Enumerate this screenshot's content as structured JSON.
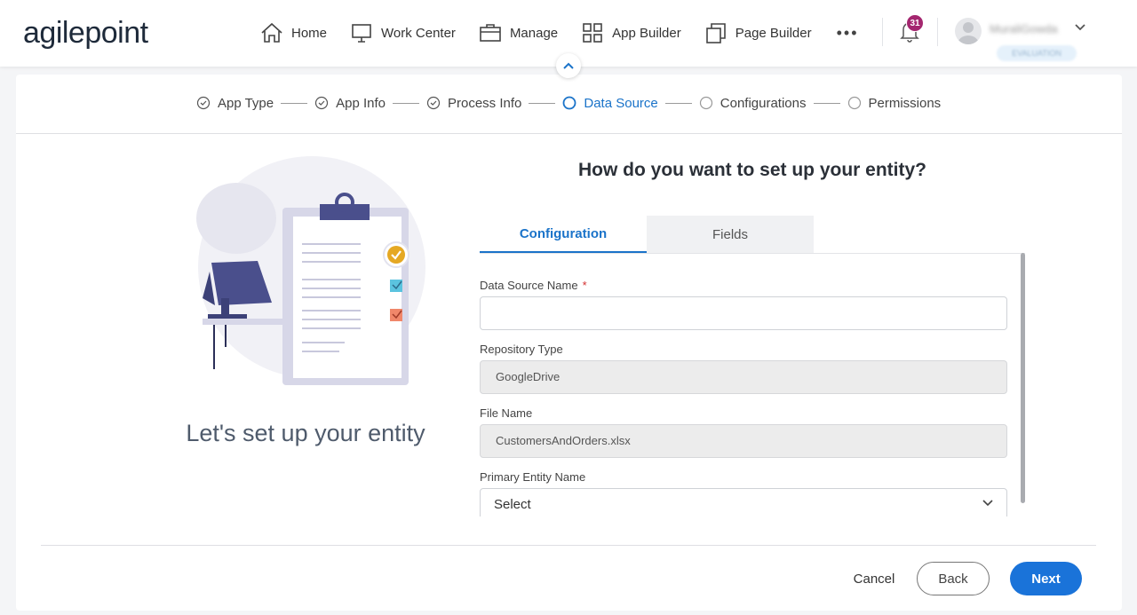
{
  "brand": {
    "logo_text": "agilepoint"
  },
  "nav": {
    "items": [
      {
        "label": "Home",
        "icon": "home-icon"
      },
      {
        "label": "Work Center",
        "icon": "monitor-icon"
      },
      {
        "label": "Manage",
        "icon": "briefcase-icon"
      },
      {
        "label": "App Builder",
        "icon": "grid-icon"
      },
      {
        "label": "Page Builder",
        "icon": "pages-icon"
      }
    ],
    "more_label": "•••",
    "notification_count": "31",
    "user_name": "MuraliGowda",
    "user_badge": "EVALUATION"
  },
  "stepper": {
    "steps": [
      {
        "label": "App Type",
        "state": "done"
      },
      {
        "label": "App Info",
        "state": "done"
      },
      {
        "label": "Process Info",
        "state": "done"
      },
      {
        "label": "Data Source",
        "state": "active"
      },
      {
        "label": "Configurations",
        "state": "pending"
      },
      {
        "label": "Permissions",
        "state": "pending"
      }
    ]
  },
  "left_panel": {
    "title": "Let's set up your entity"
  },
  "main": {
    "question": "How do you want to set up your entity?",
    "tabs": [
      {
        "label": "Configuration",
        "active": true
      },
      {
        "label": "Fields",
        "active": false
      }
    ],
    "fields": {
      "data_source_name": {
        "label": "Data Source Name",
        "required_mark": "*",
        "value": ""
      },
      "repository_type": {
        "label": "Repository Type",
        "value": "GoogleDrive"
      },
      "file_name": {
        "label": "File Name",
        "value": "CustomersAndOrders.xlsx"
      },
      "primary_entity_name": {
        "label": "Primary Entity Name",
        "value": "Select"
      }
    }
  },
  "footer": {
    "cancel_label": "Cancel",
    "back_label": "Back",
    "next_label": "Next"
  },
  "colors": {
    "accent": "#1a73c9",
    "badge": "#a4266f",
    "next_button": "#1a73d9"
  }
}
